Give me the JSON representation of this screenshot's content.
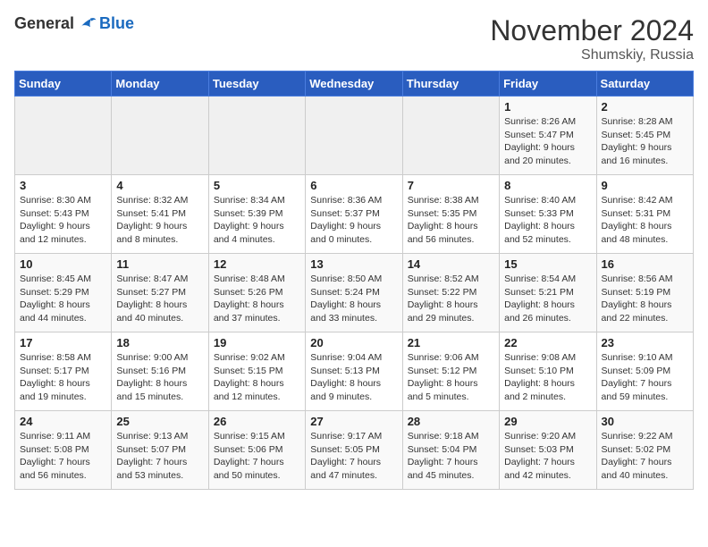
{
  "header": {
    "logo_general": "General",
    "logo_blue": "Blue",
    "month": "November 2024",
    "location": "Shumskiy, Russia"
  },
  "days_of_week": [
    "Sunday",
    "Monday",
    "Tuesday",
    "Wednesday",
    "Thursday",
    "Friday",
    "Saturday"
  ],
  "weeks": [
    [
      {
        "day": "",
        "info": ""
      },
      {
        "day": "",
        "info": ""
      },
      {
        "day": "",
        "info": ""
      },
      {
        "day": "",
        "info": ""
      },
      {
        "day": "",
        "info": ""
      },
      {
        "day": "1",
        "info": "Sunrise: 8:26 AM\nSunset: 5:47 PM\nDaylight: 9 hours and 20 minutes."
      },
      {
        "day": "2",
        "info": "Sunrise: 8:28 AM\nSunset: 5:45 PM\nDaylight: 9 hours and 16 minutes."
      }
    ],
    [
      {
        "day": "3",
        "info": "Sunrise: 8:30 AM\nSunset: 5:43 PM\nDaylight: 9 hours and 12 minutes."
      },
      {
        "day": "4",
        "info": "Sunrise: 8:32 AM\nSunset: 5:41 PM\nDaylight: 9 hours and 8 minutes."
      },
      {
        "day": "5",
        "info": "Sunrise: 8:34 AM\nSunset: 5:39 PM\nDaylight: 9 hours and 4 minutes."
      },
      {
        "day": "6",
        "info": "Sunrise: 8:36 AM\nSunset: 5:37 PM\nDaylight: 9 hours and 0 minutes."
      },
      {
        "day": "7",
        "info": "Sunrise: 8:38 AM\nSunset: 5:35 PM\nDaylight: 8 hours and 56 minutes."
      },
      {
        "day": "8",
        "info": "Sunrise: 8:40 AM\nSunset: 5:33 PM\nDaylight: 8 hours and 52 minutes."
      },
      {
        "day": "9",
        "info": "Sunrise: 8:42 AM\nSunset: 5:31 PM\nDaylight: 8 hours and 48 minutes."
      }
    ],
    [
      {
        "day": "10",
        "info": "Sunrise: 8:45 AM\nSunset: 5:29 PM\nDaylight: 8 hours and 44 minutes."
      },
      {
        "day": "11",
        "info": "Sunrise: 8:47 AM\nSunset: 5:27 PM\nDaylight: 8 hours and 40 minutes."
      },
      {
        "day": "12",
        "info": "Sunrise: 8:48 AM\nSunset: 5:26 PM\nDaylight: 8 hours and 37 minutes."
      },
      {
        "day": "13",
        "info": "Sunrise: 8:50 AM\nSunset: 5:24 PM\nDaylight: 8 hours and 33 minutes."
      },
      {
        "day": "14",
        "info": "Sunrise: 8:52 AM\nSunset: 5:22 PM\nDaylight: 8 hours and 29 minutes."
      },
      {
        "day": "15",
        "info": "Sunrise: 8:54 AM\nSunset: 5:21 PM\nDaylight: 8 hours and 26 minutes."
      },
      {
        "day": "16",
        "info": "Sunrise: 8:56 AM\nSunset: 5:19 PM\nDaylight: 8 hours and 22 minutes."
      }
    ],
    [
      {
        "day": "17",
        "info": "Sunrise: 8:58 AM\nSunset: 5:17 PM\nDaylight: 8 hours and 19 minutes."
      },
      {
        "day": "18",
        "info": "Sunrise: 9:00 AM\nSunset: 5:16 PM\nDaylight: 8 hours and 15 minutes."
      },
      {
        "day": "19",
        "info": "Sunrise: 9:02 AM\nSunset: 5:15 PM\nDaylight: 8 hours and 12 minutes."
      },
      {
        "day": "20",
        "info": "Sunrise: 9:04 AM\nSunset: 5:13 PM\nDaylight: 8 hours and 9 minutes."
      },
      {
        "day": "21",
        "info": "Sunrise: 9:06 AM\nSunset: 5:12 PM\nDaylight: 8 hours and 5 minutes."
      },
      {
        "day": "22",
        "info": "Sunrise: 9:08 AM\nSunset: 5:10 PM\nDaylight: 8 hours and 2 minutes."
      },
      {
        "day": "23",
        "info": "Sunrise: 9:10 AM\nSunset: 5:09 PM\nDaylight: 7 hours and 59 minutes."
      }
    ],
    [
      {
        "day": "24",
        "info": "Sunrise: 9:11 AM\nSunset: 5:08 PM\nDaylight: 7 hours and 56 minutes."
      },
      {
        "day": "25",
        "info": "Sunrise: 9:13 AM\nSunset: 5:07 PM\nDaylight: 7 hours and 53 minutes."
      },
      {
        "day": "26",
        "info": "Sunrise: 9:15 AM\nSunset: 5:06 PM\nDaylight: 7 hours and 50 minutes."
      },
      {
        "day": "27",
        "info": "Sunrise: 9:17 AM\nSunset: 5:05 PM\nDaylight: 7 hours and 47 minutes."
      },
      {
        "day": "28",
        "info": "Sunrise: 9:18 AM\nSunset: 5:04 PM\nDaylight: 7 hours and 45 minutes."
      },
      {
        "day": "29",
        "info": "Sunrise: 9:20 AM\nSunset: 5:03 PM\nDaylight: 7 hours and 42 minutes."
      },
      {
        "day": "30",
        "info": "Sunrise: 9:22 AM\nSunset: 5:02 PM\nDaylight: 7 hours and 40 minutes."
      }
    ]
  ]
}
